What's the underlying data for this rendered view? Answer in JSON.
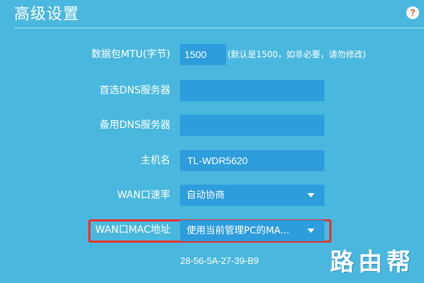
{
  "page": {
    "title": "高级设置"
  },
  "form": {
    "mtu": {
      "label": "数据包MTU(字节)",
      "value": "1500",
      "hint": "(默认是1500，如非必要，请勿修改)"
    },
    "primary_dns": {
      "label": "首选DNS服务器",
      "value": ""
    },
    "secondary_dns": {
      "label": "备用DNS服务器",
      "value": ""
    },
    "hostname": {
      "label": "主机名",
      "value": "TL-WDR5620"
    },
    "wan_speed": {
      "label": "WAN口速率",
      "selected": "自动协商"
    },
    "wan_mac": {
      "label": "WAN口MAC地址",
      "selected": "使用当前管理PC的MA...",
      "mac_value": "28-56-5A-27-39-B9"
    }
  },
  "icons": {
    "help": "help-icon",
    "dropdown": "chevron-down-icon"
  },
  "watermark": "路由帮",
  "colors": {
    "background": "#4ab8de",
    "field": "#2d9ddc",
    "highlight": "#e8312c",
    "help_icon": "#e8541c"
  }
}
